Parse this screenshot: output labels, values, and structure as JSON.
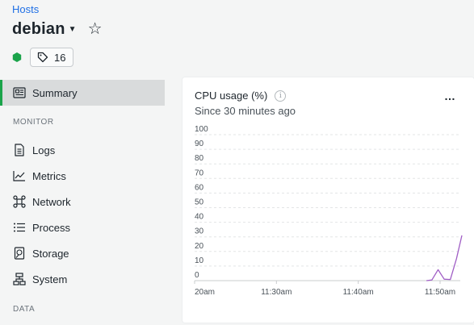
{
  "header": {
    "breadcrumb": "Hosts",
    "title": "debian",
    "tag_count": "16",
    "health_color": "#1aa34a"
  },
  "sidebar": {
    "active": {
      "label": "Summary",
      "icon": "summary-icon"
    },
    "sections": [
      {
        "label": "MONITOR",
        "items": [
          {
            "label": "Logs",
            "icon": "logs-icon"
          },
          {
            "label": "Metrics",
            "icon": "metrics-icon"
          },
          {
            "label": "Network",
            "icon": "network-icon"
          },
          {
            "label": "Process",
            "icon": "process-icon"
          },
          {
            "label": "Storage",
            "icon": "storage-icon"
          },
          {
            "label": "System",
            "icon": "system-icon"
          }
        ]
      },
      {
        "label": "DATA",
        "items": []
      }
    ],
    "accent": "#1aa34a"
  },
  "card": {
    "title": "CPU usage (%)",
    "subtitle": "Since 30 minutes ago",
    "more_label": "…"
  },
  "chart_data": {
    "type": "line",
    "title": "CPU usage (%)",
    "ylim": [
      0,
      100
    ],
    "y_ticks": [
      0,
      10,
      20,
      30,
      40,
      50,
      60,
      70,
      80,
      90,
      100
    ],
    "x_ticks": [
      "20am",
      "11:30am",
      "11:40am",
      "11:50am"
    ],
    "series": [
      {
        "color": "#a05ec5",
        "x": [
          "11:48:20",
          "11:49:00",
          "11:49:45",
          "11:50:30",
          "11:51:15",
          "11:52:00",
          "11:52:40"
        ],
        "values": [
          0,
          0.5,
          7.5,
          1,
          0.8,
          15,
          31
        ]
      }
    ],
    "grid": true
  }
}
